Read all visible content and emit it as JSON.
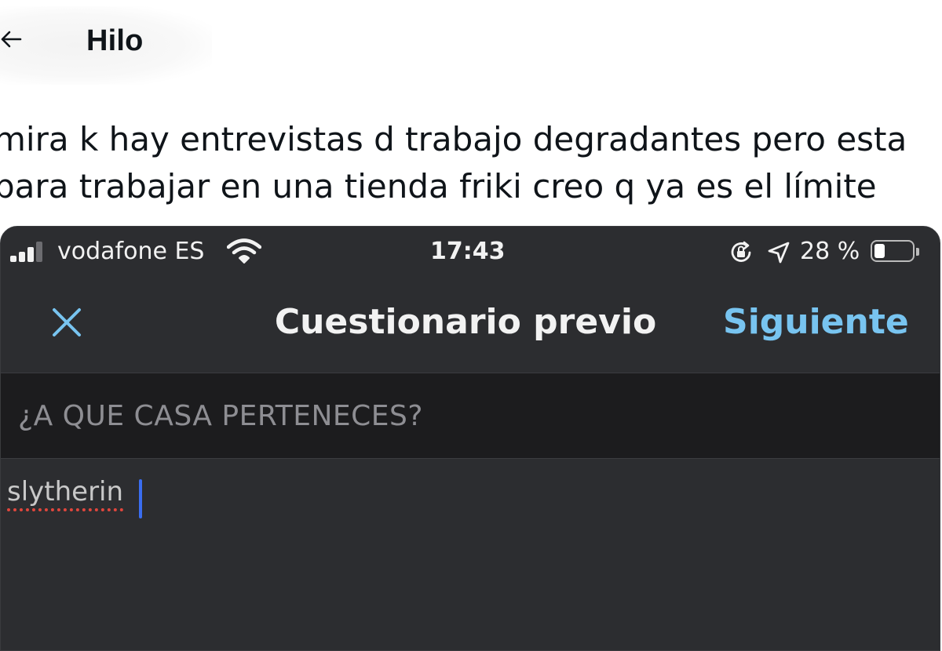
{
  "header": {
    "title": "Hilo",
    "back_icon": "arrow-left-icon"
  },
  "tweet": {
    "lines": [
      "mira k hay entrevistas d trabajo degradantes pero esta",
      "para trabajar en una tienda friki creo q ya es el límite"
    ]
  },
  "phone": {
    "status": {
      "carrier": "vodafone ES",
      "time": "17:43",
      "battery_percent": "28 %",
      "battery_level": 0.28
    },
    "nav": {
      "title": "Cuestionario previo",
      "next_label": "Siguiente",
      "close_icon": "close-icon"
    },
    "question": "¿A QUE CASA PERTENECES?",
    "answer": "slytherin"
  },
  "colors": {
    "link_blue": "#78c4f0",
    "phone_bg": "#2c2d30",
    "section_bg": "#1c1c1e",
    "caret": "#3a6df0",
    "spellcheck": "#e0463d"
  }
}
